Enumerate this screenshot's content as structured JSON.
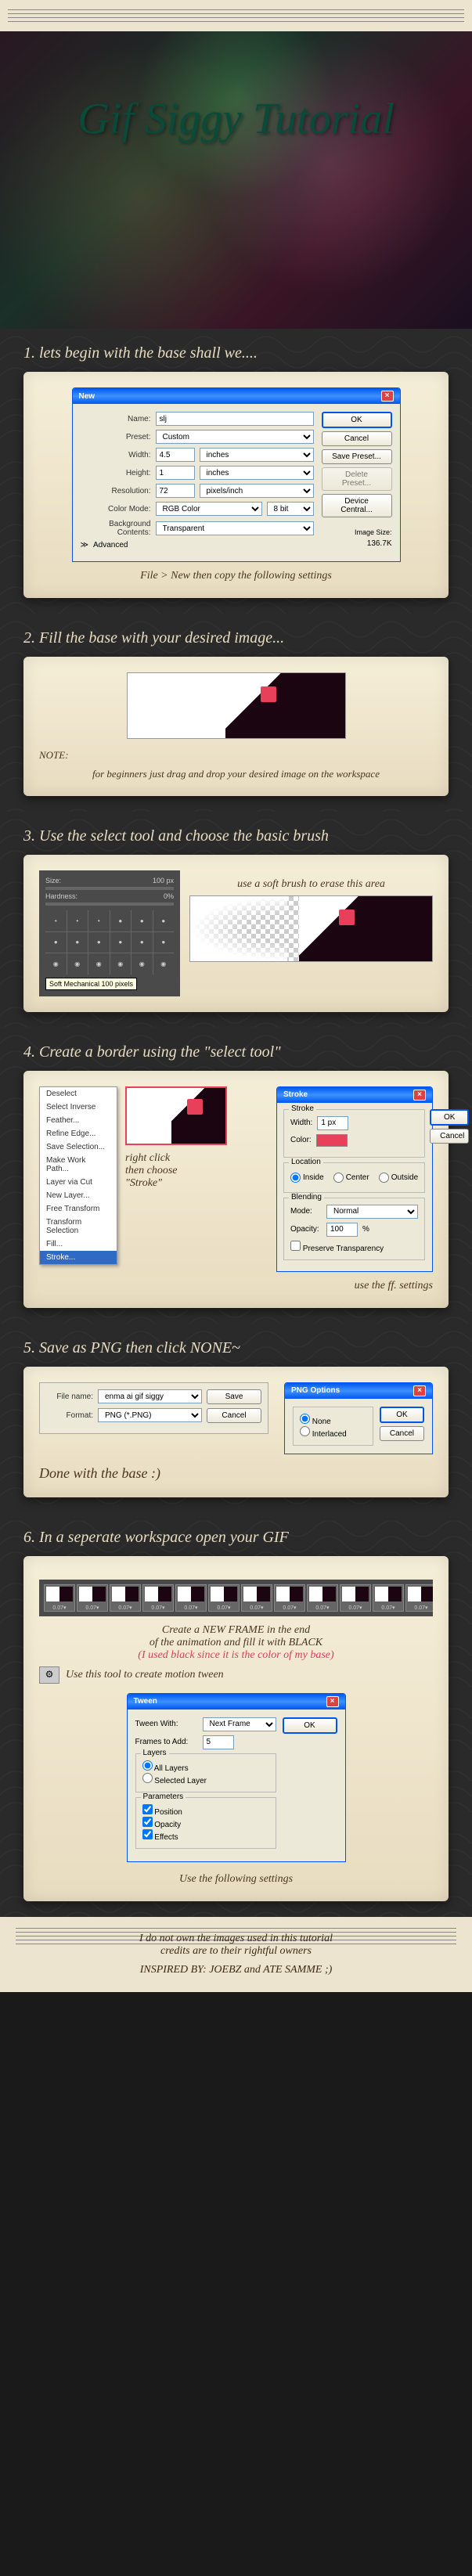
{
  "hero": {
    "title": "Gif Siggy Tutorial"
  },
  "steps": {
    "s1": {
      "title": "1. lets begin with the base shall we....",
      "caption": "File > New then copy the following settings"
    },
    "s2": {
      "title": "2. Fill the base with your desired image...",
      "note_label": "NOTE:",
      "note": "for beginners just drag and drop your desired image on the workspace"
    },
    "s3": {
      "title": "3. Use the select tool and choose the basic brush",
      "hint": "use a soft brush to erase this area"
    },
    "s4": {
      "title": "4. Create a border using the \"select tool\"",
      "hint1": "right click",
      "hint2": "then choose",
      "hint3": "\"Stroke\"",
      "caption": "use the ff. settings"
    },
    "s5": {
      "title": "5. Save as PNG then click NONE~",
      "done": "Done with the base :)"
    },
    "s6": {
      "title": "6. In a seperate workspace open your GIF",
      "line1": "Create a NEW FRAME in the end",
      "line2": "of the animation and fill it with BLACK",
      "line3": "(I used black since it is the color of my base)",
      "line4": "Use this tool to create motion tween",
      "caption": "Use the following settings"
    }
  },
  "new_dialog": {
    "title": "New",
    "name_label": "Name:",
    "name_value": "slj",
    "preset_label": "Preset:",
    "preset_value": "Custom",
    "width_label": "Width:",
    "width_value": "4.5",
    "width_unit": "inches",
    "height_label": "Height:",
    "height_value": "1",
    "height_unit": "inches",
    "res_label": "Resolution:",
    "res_value": "72",
    "res_unit": "pixels/inch",
    "mode_label": "Color Mode:",
    "mode_value": "RGB Color",
    "depth": "8 bit",
    "bg_label": "Background Contents:",
    "bg_value": "Transparent",
    "adv": "Advanced",
    "imgsize_label": "Image Size:",
    "imgsize_value": "136.7K",
    "ok": "OK",
    "cancel": "Cancel",
    "save_preset": "Save Preset...",
    "del_preset": "Delete Preset...",
    "device": "Device Central..."
  },
  "brush": {
    "size_label": "Size:",
    "size_value": "100 px",
    "hardness_label": "Hardness:",
    "hardness_value": "0%",
    "tooltip": "Soft Mechanical 100 pixels"
  },
  "context_items": [
    "Deselect",
    "Select Inverse",
    "Feather...",
    "Refine Edge...",
    "Save Selection...",
    "Make Work Path...",
    "Layer via Cut",
    "New Layer...",
    "Free Transform",
    "Transform Selection",
    "Fill...",
    "Stroke..."
  ],
  "stroke_dialog": {
    "title": "Stroke",
    "group": "Stroke",
    "width_label": "Width:",
    "width_value": "1 px",
    "color_label": "Color:",
    "loc_group": "Location",
    "loc_inside": "Inside",
    "loc_center": "Center",
    "loc_outside": "Outside",
    "blend_group": "Blending",
    "mode_label": "Mode:",
    "mode_value": "Normal",
    "opacity_label": "Opacity:",
    "opacity_value": "100",
    "pct": "%",
    "preserve": "Preserve Transparency",
    "ok": "OK",
    "cancel": "Cancel"
  },
  "save_dialog": {
    "fname_label": "File name:",
    "fname_value": "enma ai gif siggy",
    "format_label": "Format:",
    "format_value": "PNG (*.PNG)",
    "save": "Save",
    "cancel": "Cancel"
  },
  "png_dialog": {
    "title": "PNG Options",
    "none": "None",
    "interlaced": "Interlaced",
    "ok": "OK",
    "cancel": "Cancel"
  },
  "frame_time": "0.07",
  "tween_dialog": {
    "title": "Tween",
    "tween_with_label": "Tween With:",
    "tween_with_value": "Next Frame",
    "frames_label": "Frames to Add:",
    "frames_value": "5",
    "layers_group": "Layers",
    "all": "All Layers",
    "sel": "Selected Layer",
    "params_group": "Parameters",
    "pos": "Position",
    "op": "Opacity",
    "eff": "Effects",
    "ok": "OK"
  },
  "footer": {
    "line1": "I do not own the images used in this tutorial",
    "line2": "credits are to their rightful owners",
    "line3": "INSPIRED BY: JOEBZ and ATE SAMME ;)"
  }
}
